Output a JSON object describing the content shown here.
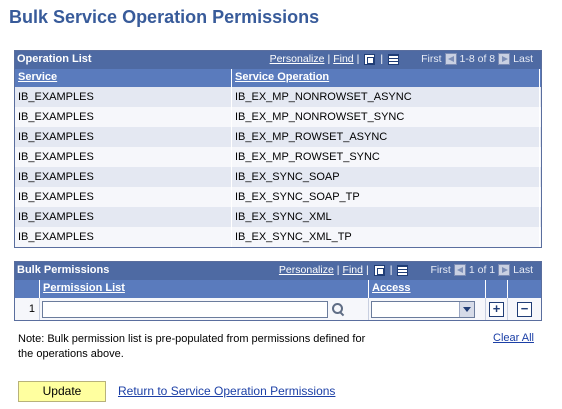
{
  "page": {
    "title": "Bulk Service Operation Permissions"
  },
  "operation_list": {
    "title": "Operation List",
    "personalize": "Personalize",
    "find": "Find",
    "first": "First",
    "range": "1-8 of 8",
    "last": "Last",
    "columns": {
      "service": "Service",
      "service_operation": "Service Operation"
    },
    "rows": [
      {
        "service": "IB_EXAMPLES",
        "operation": "IB_EX_MP_NONROWSET_ASYNC"
      },
      {
        "service": "IB_EXAMPLES",
        "operation": "IB_EX_MP_NONROWSET_SYNC"
      },
      {
        "service": "IB_EXAMPLES",
        "operation": "IB_EX_MP_ROWSET_ASYNC"
      },
      {
        "service": "IB_EXAMPLES",
        "operation": "IB_EX_MP_ROWSET_SYNC"
      },
      {
        "service": "IB_EXAMPLES",
        "operation": "IB_EX_SYNC_SOAP"
      },
      {
        "service": "IB_EXAMPLES",
        "operation": "IB_EX_SYNC_SOAP_TP"
      },
      {
        "service": "IB_EXAMPLES",
        "operation": "IB_EX_SYNC_XML"
      },
      {
        "service": "IB_EXAMPLES",
        "operation": "IB_EX_SYNC_XML_TP"
      }
    ]
  },
  "bulk_permissions": {
    "title": "Bulk Permissions",
    "personalize": "Personalize",
    "find": "Find",
    "first": "First",
    "range": "1 of 1",
    "last": "Last",
    "columns": {
      "permission_list": "Permission List",
      "access": "Access"
    },
    "row_number": "1",
    "permission_list_value": "",
    "access_value": ""
  },
  "note": "Note: Bulk permission list is pre-populated from permissions defined for the operations above.",
  "clear_all": "Clear All",
  "update_button": "Update",
  "return_link": "Return to Service Operation Permissions",
  "colors": {
    "title": "#385b9a",
    "grid_header": "#4e6aa3",
    "column_header": "#5a7bbd",
    "button": "#ffff9f",
    "link": "#1b3fa6"
  }
}
